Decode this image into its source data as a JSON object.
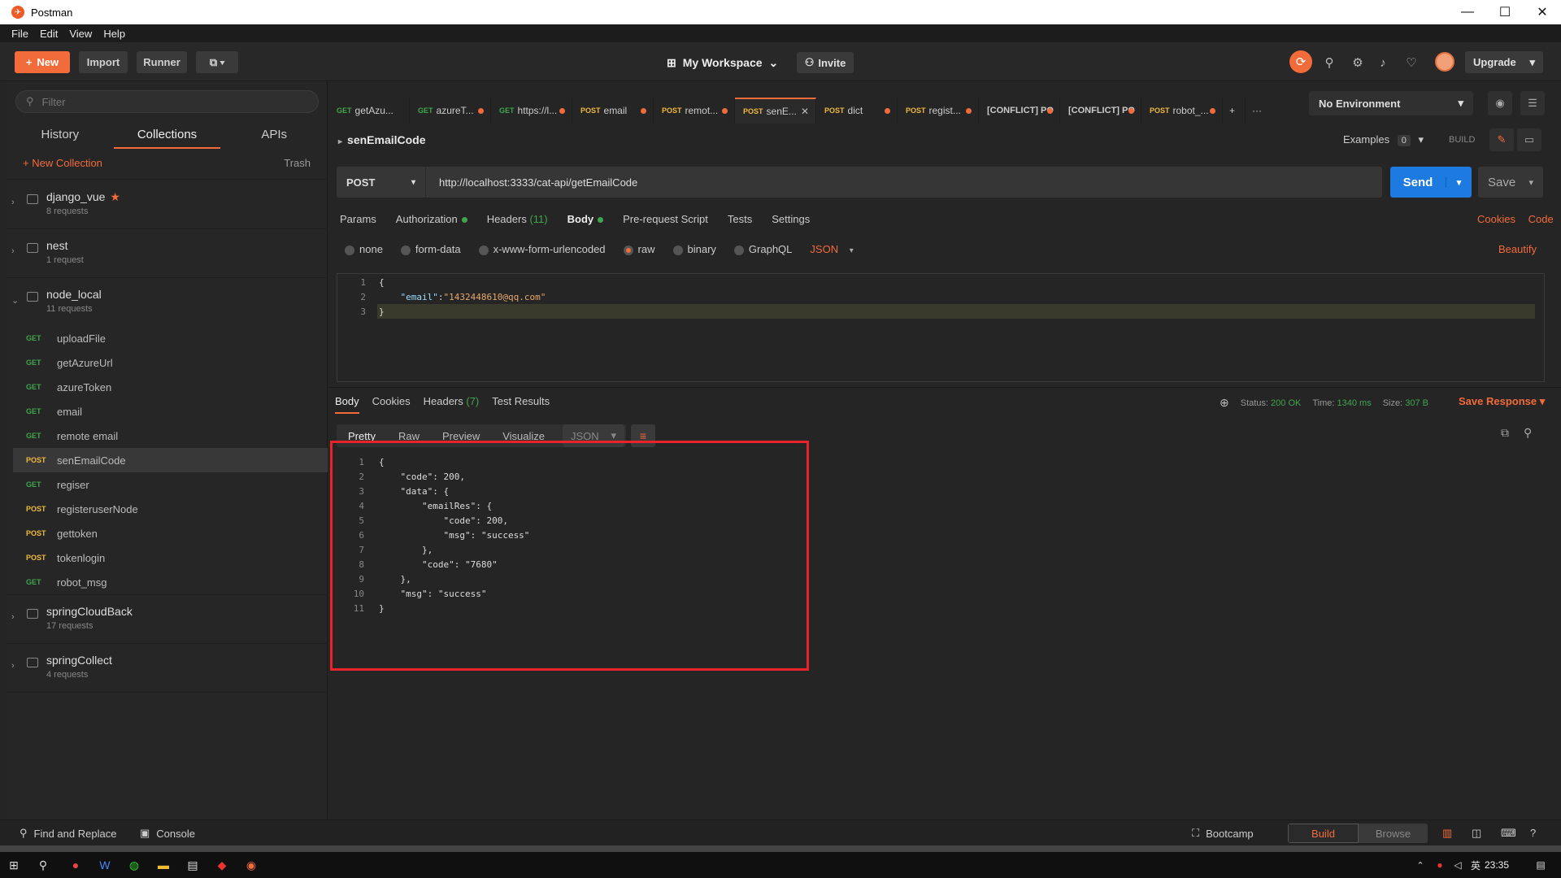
{
  "window": {
    "title": "Postman",
    "minimize": "—",
    "maximize": "☐",
    "close": "✕"
  },
  "menu": [
    "File",
    "Edit",
    "View",
    "Help"
  ],
  "toolbar": {
    "new_label": "New",
    "import_label": "Import",
    "runner_label": "Runner",
    "workspace_label": "My Workspace",
    "invite_label": "Invite",
    "upgrade_label": "Upgrade"
  },
  "sidebar": {
    "filter_placeholder": "Filter",
    "tabs": [
      "History",
      "Collections",
      "APIs"
    ],
    "active_tab": "Collections",
    "new_collection_label": "+ New Collection",
    "trash_label": "Trash",
    "collections": [
      {
        "name": "django_vue",
        "count": "8 requests",
        "starred": true
      },
      {
        "name": "nest",
        "count": "1 request"
      },
      {
        "name": "node_local",
        "count": "11 requests",
        "expanded": true
      },
      {
        "name": "springCloudBack",
        "count": "17 requests"
      },
      {
        "name": "springCollect",
        "count": "4 requests"
      }
    ],
    "requests": [
      {
        "method": "GET",
        "name": "uploadFile"
      },
      {
        "method": "GET",
        "name": "getAzureUrl"
      },
      {
        "method": "GET",
        "name": "azureToken"
      },
      {
        "method": "GET",
        "name": "email"
      },
      {
        "method": "GET",
        "name": "remote email"
      },
      {
        "method": "POST",
        "name": "senEmailCode",
        "selected": true
      },
      {
        "method": "GET",
        "name": "regiser"
      },
      {
        "method": "POST",
        "name": "registeruserNode"
      },
      {
        "method": "POST",
        "name": "gettoken"
      },
      {
        "method": "POST",
        "name": "tokenlogin"
      },
      {
        "method": "GET",
        "name": "robot_msg"
      }
    ]
  },
  "request_tabs": [
    {
      "method": "GET",
      "label": "getAzu..."
    },
    {
      "method": "GET",
      "label": "azureT...",
      "dot": true
    },
    {
      "method": "GET",
      "label": "https://l...",
      "dot": true
    },
    {
      "method": "POST",
      "label": "email",
      "dot": true
    },
    {
      "method": "POST",
      "label": "remot...",
      "dot": true
    },
    {
      "method": "POST",
      "label": "senE...",
      "active": true,
      "close": "✕"
    },
    {
      "method": "POST",
      "label": "dict",
      "dot": true
    },
    {
      "method": "POST",
      "label": "regist...",
      "dot": true
    },
    {
      "method": "",
      "label": "[CONFLICT] PO",
      "dot": true
    },
    {
      "method": "",
      "label": "[CONFLICT] PO",
      "dot": true
    },
    {
      "method": "POST",
      "label": "robot_...",
      "dot": true
    }
  ],
  "environment": {
    "label": "No Environment"
  },
  "request": {
    "name": "senEmailCode",
    "examples_label": "Examples",
    "examples_count": "0",
    "build_label": "BUILD",
    "method": "POST",
    "url": "http://localhost:3333/cat-api/getEmailCode",
    "send_label": "Send",
    "save_label": "Save",
    "tabs": {
      "params": "Params",
      "authorization": "Authorization",
      "headers": "Headers",
      "headers_count": "(11)",
      "body": "Body",
      "prerequest": "Pre-request Script",
      "tests": "Tests",
      "settings": "Settings"
    },
    "cookies_label": "Cookies",
    "code_label": "Code",
    "body_options": [
      "none",
      "form-data",
      "x-www-form-urlencoded",
      "raw",
      "binary",
      "GraphQL"
    ],
    "selected_option": "raw",
    "format": "JSON",
    "beautify_label": "Beautify",
    "body_lines": [
      "{",
      "    \"email\":\"1432448610@qq.com\"",
      "}"
    ]
  },
  "response": {
    "tabs": {
      "body": "Body",
      "cookies": "Cookies",
      "headers": "Headers",
      "headers_count": "(7)",
      "tests": "Test Results"
    },
    "status_label": "Status:",
    "status_value": "200 OK",
    "time_label": "Time:",
    "time_value": "1340 ms",
    "size_label": "Size:",
    "size_value": "307 B",
    "save_response_label": "Save Response",
    "views": [
      "Pretty",
      "Raw",
      "Preview",
      "Visualize"
    ],
    "active_view": "Pretty",
    "format": "JSON",
    "lines": [
      "{",
      "    \"code\": 200,",
      "    \"data\": {",
      "        \"emailRes\": {",
      "            \"code\": 200,",
      "            \"msg\": \"success\"",
      "        },",
      "        \"code\": \"7680\"",
      "    },",
      "    \"msg\": \"success\"",
      "}"
    ]
  },
  "footer": {
    "find_replace": "Find and Replace",
    "console": "Console",
    "bootcamp": "Bootcamp",
    "build": "Build",
    "browse": "Browse"
  },
  "taskbar": {
    "time": "23:35",
    "ime": "英"
  },
  "colors": {
    "accent": "#f26b3a",
    "send": "#1c7ae0",
    "get": "#3fa64d",
    "post": "#f0b93b",
    "highlight_box": "#e8232a"
  }
}
